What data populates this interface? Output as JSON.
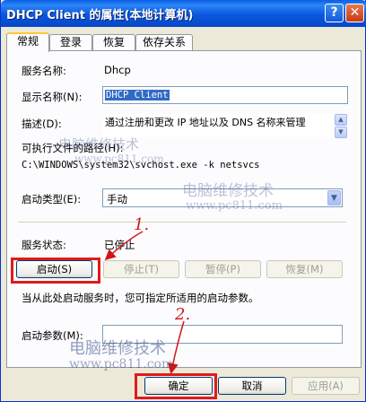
{
  "window": {
    "title": "DHCP Client 的属性(本地计算机)",
    "help_glyph": "?",
    "close_glyph": "✕"
  },
  "tabs": [
    "常规",
    "登录",
    "恢复",
    "依存关系"
  ],
  "general": {
    "service_name_label": "服务名称:",
    "service_name": "Dhcp",
    "display_name_label": "显示名称(N):",
    "display_name": "DHCP Client",
    "description_label": "描述(D):",
    "description": "通过注册和更改 IP 地址以及 DNS 名称来管理",
    "exe_path_label": "可执行文件的路径(H):",
    "exe_path": "C:\\WINDOWS\\system32\\svchost.exe -k netsvcs",
    "startup_type_label": "启动类型(E):",
    "startup_type": "手动",
    "status_label": "服务状态:",
    "status": "已停止",
    "buttons": {
      "start": "启动(S)",
      "stop": "停止(T)",
      "pause": "暂停(P)",
      "resume": "恢复(M)"
    },
    "hint": "当从此处启动服务时，您可指定所适用的启动参数。",
    "params_label": "启动参数(M):",
    "params_value": ""
  },
  "footer": {
    "ok": "确定",
    "cancel": "取消",
    "apply": "应用(A)"
  },
  "annotations": {
    "step1": "1.",
    "step2": "2."
  },
  "watermarks": {
    "brand": "电脑维修技术",
    "url": "www.pc811.com"
  },
  "colors": {
    "accent_red": "#e01b1b",
    "title_blue": "#0b57dd",
    "selection": "#316ac5"
  }
}
